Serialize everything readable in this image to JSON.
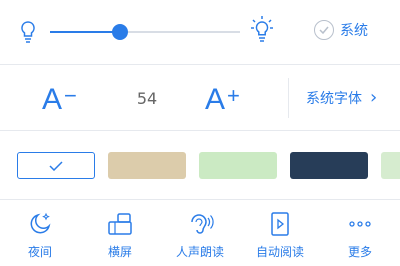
{
  "brightness": {
    "value": 0.368,
    "system_label": "系统",
    "low_icon": "bulb-dim-icon",
    "high_icon": "bulb-bright-icon"
  },
  "font": {
    "decrease_label": "A",
    "decrease_sign": "−",
    "increase_label": "A",
    "increase_sign": "+",
    "size": "54",
    "system_font_label": "系统字体",
    "system_font_arrow": "›"
  },
  "themes": [
    {
      "name": "white",
      "color": "#ffffff",
      "selected": true
    },
    {
      "name": "beige",
      "color": "#dcccab",
      "selected": false
    },
    {
      "name": "green",
      "color": "#cbeac3",
      "selected": false
    },
    {
      "name": "navy",
      "color": "#273d58",
      "selected": false
    },
    {
      "name": "light-green",
      "color": "#d6eccf",
      "selected": false
    }
  ],
  "toolbar": [
    {
      "label": "夜间",
      "icon": "moon-icon"
    },
    {
      "label": "横屏",
      "icon": "landscape-icon"
    },
    {
      "label": "人声朗读",
      "icon": "voice-read-icon"
    },
    {
      "label": "自动阅读",
      "icon": "auto-read-icon"
    },
    {
      "label": "更多",
      "icon": "more-icon"
    }
  ],
  "colors": {
    "accent": "#2a7ce8",
    "divider": "#e6e9ee"
  }
}
